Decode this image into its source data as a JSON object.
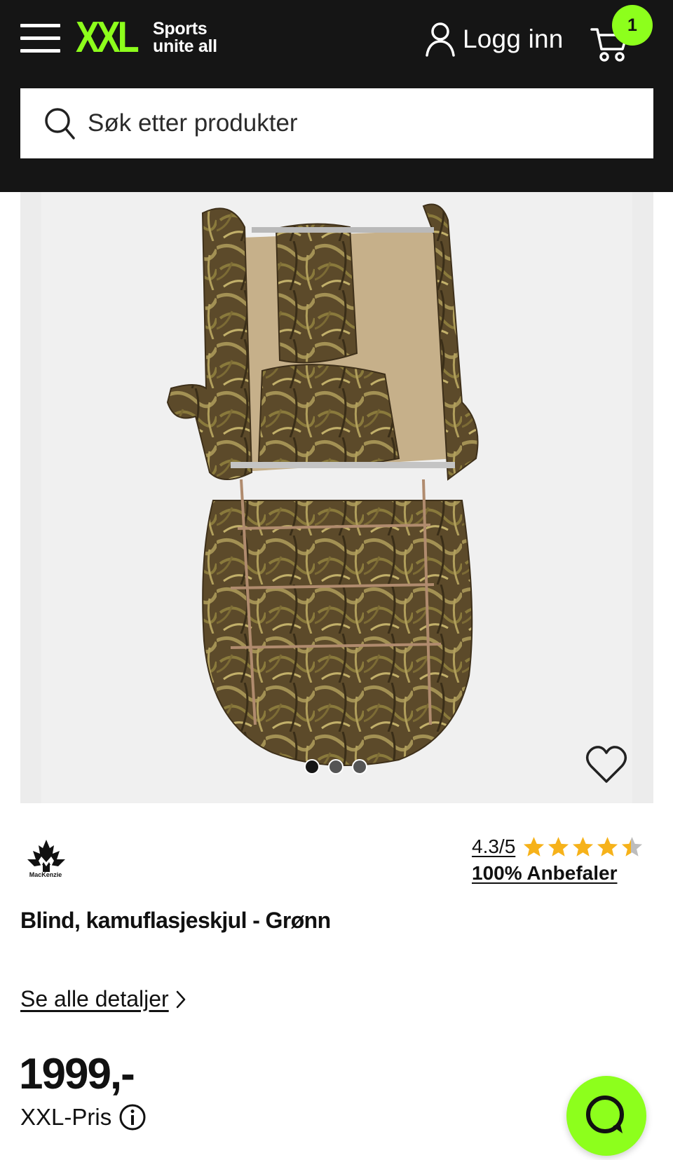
{
  "header": {
    "logo_mark": "XXL",
    "logo_tagline_1": "Sports",
    "logo_tagline_2": "unite all",
    "login_label": "Logg inn",
    "cart_count": "1",
    "accent_color": "#8dff1c",
    "background_color": "#151515"
  },
  "search": {
    "placeholder": "Søk etter produkter",
    "icon": "search-icon"
  },
  "gallery": {
    "image_count": 3,
    "active_index": 0,
    "favorite_icon": "heart-icon"
  },
  "product": {
    "brand": "MacKenzie",
    "rating_text": "4.3/5",
    "rating_value": 4.3,
    "rating_max": 5,
    "recommend_text": "100% Anbefaler",
    "title": "Blind, kamuflasjeskjul - Grønn",
    "details_link": "Se alle detaljer",
    "price": "1999,-",
    "price_label": "XXL-Pris"
  },
  "chat": {
    "icon": "chat-icon"
  }
}
